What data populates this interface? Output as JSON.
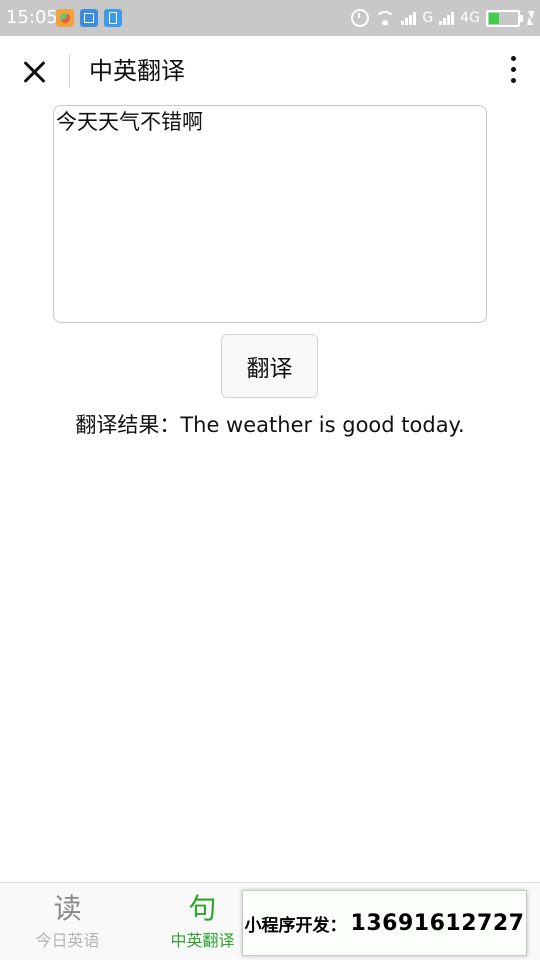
{
  "status_bar": {
    "time": "15:05",
    "network_label_1": "G",
    "network_label_2": "4G"
  },
  "nav": {
    "title": "中英翻译"
  },
  "input": {
    "value": "今天天气不错啊"
  },
  "translate_button": {
    "label": "翻译"
  },
  "result": {
    "prefix": "翻译结果：",
    "text": "The weather is good today."
  },
  "tab_bar": {
    "tabs": [
      {
        "icon_char": "读",
        "label": "今日英语",
        "active": false
      },
      {
        "icon_char": "句",
        "label": "中英翻译",
        "active": true
      }
    ]
  },
  "banner": {
    "label": "小程序开发：",
    "phone": "13691612727"
  },
  "colors": {
    "status_bar_bg": "#c8c8c8",
    "accent_green": "#2fa52f",
    "inactive_tab_text": "#b5b5b5"
  }
}
